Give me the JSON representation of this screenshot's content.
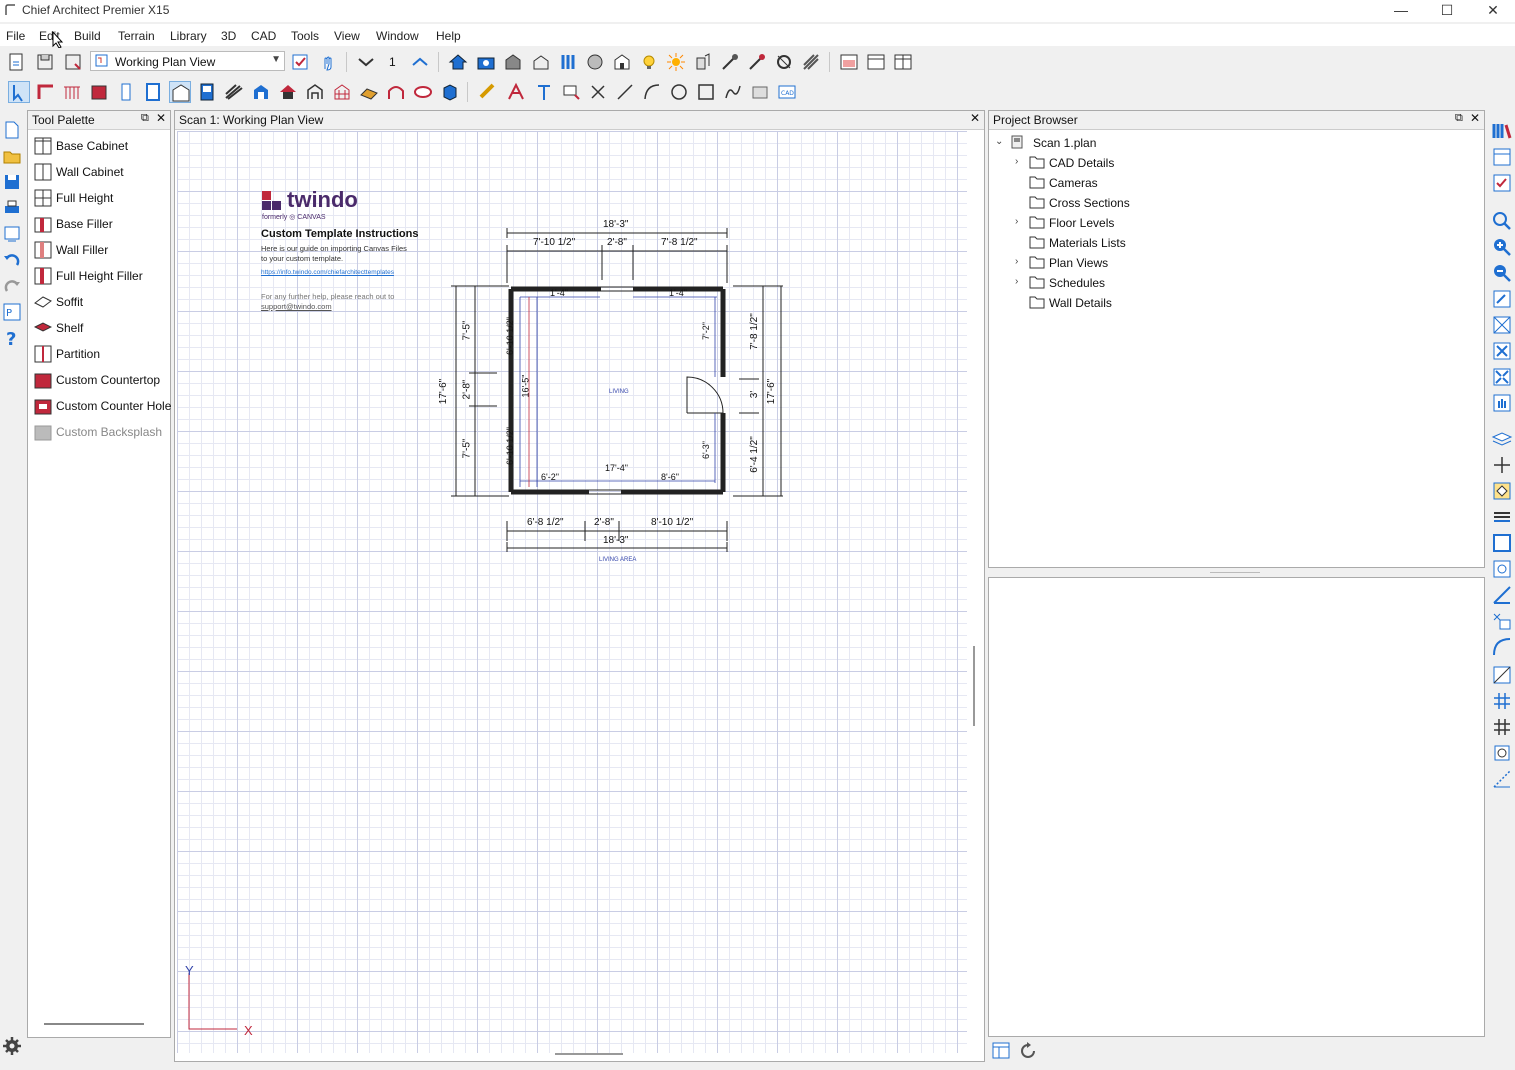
{
  "window": {
    "title": "Chief Architect Premier X15",
    "minimize": "—",
    "maximize": "☐",
    "close": "✕"
  },
  "menu": [
    "File",
    "Edit",
    "Build",
    "Terrain",
    "Library",
    "3D",
    "CAD",
    "Tools",
    "View",
    "Window",
    "Help"
  ],
  "toolbar": {
    "view_select": "Working Plan View",
    "layer_number": "1"
  },
  "palette": {
    "title": "Tool Palette",
    "items": [
      {
        "label": "Base Cabinet",
        "enabled": true
      },
      {
        "label": "Wall Cabinet",
        "enabled": true
      },
      {
        "label": "Full Height",
        "enabled": true
      },
      {
        "label": "Base Filler",
        "enabled": true
      },
      {
        "label": "Wall Filler",
        "enabled": true
      },
      {
        "label": "Full Height Filler",
        "enabled": true
      },
      {
        "label": "Soffit",
        "enabled": true
      },
      {
        "label": "Shelf",
        "enabled": true
      },
      {
        "label": "Partition",
        "enabled": true
      },
      {
        "label": "Custom Countertop",
        "enabled": true
      },
      {
        "label": "Custom Counter Hole",
        "enabled": true
      },
      {
        "label": "Custom Backsplash",
        "enabled": false
      }
    ]
  },
  "plan": {
    "tab_title": "Scan 1:  Working Plan View",
    "logo_text": "twindo",
    "logo_sub": "formerly ◎ CANVAS",
    "instructions_title": "Custom Template Instructions",
    "instructions_line1": "Here is our guide on importing Canvas Files",
    "instructions_line2": "to your custom template.",
    "instructions_link": "https://info.twindo.com/chiefarchitecttemplates",
    "help_line": "For any further help, please reach out to",
    "help_email": "support@twindo.com",
    "dims": {
      "top_total": "18'-3\"",
      "top_left": "7'-10 1/2\"",
      "top_mid": "2'-8\"",
      "top_right": "7'-8 1/2\"",
      "bottom_left": "6'-8 1/2\"",
      "bottom_mid": "2'-8\"",
      "bottom_right": "8'-10 1/2\"",
      "bottom_total": "18'-3\"",
      "left_total": "17'-6\"",
      "left_top": "7'-5\"",
      "left_mid": "2'-8\"",
      "left_bottom": "7'-5\"",
      "right_total": "17'-6\"",
      "right_top": "7'-8 1/2\"",
      "right_mid": "3'",
      "right_bottom": "6'-4 1/2\"",
      "in_top_l": "1'-4\"",
      "in_top_r": "1'-4\"",
      "in_right": "7'-2\"",
      "in_right_b": "6'-3\"",
      "in_left_t": "6'-10 1/2\"",
      "in_left_b": "6'-10 1/2\"",
      "in_left_v": "16'-5\"",
      "in_bottom_l": "6'-2\"",
      "in_bottom_mid": "17'-4\"",
      "in_bottom_r": "8'-6\""
    },
    "room_label": "LIVING",
    "area_label": "LIVING AREA",
    "axis_y": "Y",
    "axis_x": "X"
  },
  "browser": {
    "title": "Project Browser",
    "root": "Scan 1.plan",
    "nodes": [
      {
        "label": "CAD Details",
        "expandable": true
      },
      {
        "label": "Cameras",
        "expandable": false
      },
      {
        "label": "Cross Sections",
        "expandable": false
      },
      {
        "label": "Floor Levels",
        "expandable": true
      },
      {
        "label": "Materials Lists",
        "expandable": false
      },
      {
        "label": "Plan Views",
        "expandable": true
      },
      {
        "label": "Schedules",
        "expandable": true
      },
      {
        "label": "Wall Details",
        "expandable": false
      }
    ]
  },
  "colors": {
    "accent": "#1f6fd1",
    "twindo_purple": "#4a2a6b",
    "twindo_red": "#c0283c",
    "wall": "#222222",
    "dim_blue": "#3344aa"
  }
}
